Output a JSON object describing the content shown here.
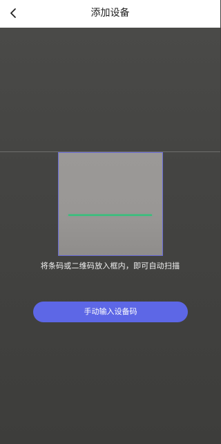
{
  "header": {
    "title": "添加设备",
    "back_icon": "chevron-left-icon"
  },
  "scanner": {
    "hint": "将条码或二维码放入框内，即可自动扫描",
    "frame_color": "#6a6cd8",
    "scan_line_color": "#2ec37a"
  },
  "actions": {
    "manual_input_label": "手动输入设备码",
    "button_color": "#5d67e6"
  }
}
